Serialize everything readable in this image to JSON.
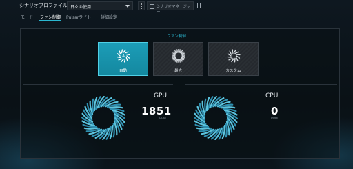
{
  "topbar": {
    "profile_label": "シナリオプロファイル",
    "profile_value": "日々の使用",
    "scenario_manager_label": "シナリオマネージャー"
  },
  "tabs": [
    {
      "label": "モード",
      "active": false
    },
    {
      "label": "ファン制御",
      "active": true
    },
    {
      "label": "Pulsarライト",
      "active": false
    },
    {
      "label": "詳細設定",
      "active": false
    }
  ],
  "fan_control": {
    "title": "ファン制御",
    "modes": [
      {
        "label": "自動",
        "icon": "fan-auto-icon",
        "active": true
      },
      {
        "label": "最大",
        "icon": "fan-max-icon",
        "active": false
      },
      {
        "label": "カスタム",
        "icon": "fan-custom-icon",
        "active": false
      }
    ]
  },
  "gauges": {
    "gpu": {
      "name": "GPU",
      "value": "1851",
      "unit": "RPM"
    },
    "cpu": {
      "name": "CPU",
      "value": "0",
      "unit": "RPM"
    }
  },
  "colors": {
    "accent": "#2bb7d0",
    "active_button": "#1c9db8",
    "background": "#0b1218"
  }
}
